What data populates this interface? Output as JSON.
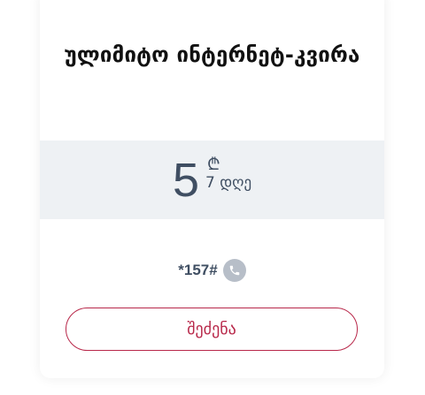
{
  "card": {
    "title": "ულიმიტო ინტერნეტ-კვირა",
    "price": {
      "amount": "5",
      "currency_symbol": "₾",
      "duration": "7 დღე"
    },
    "ussd": {
      "code": "*157#",
      "icon": "phone-icon"
    },
    "buy_label": "შეძენა"
  },
  "colors": {
    "accent": "#b8284a",
    "text_dark": "#3f4e62",
    "band_bg": "#eef1f4",
    "icon_bg": "#b7bec8"
  }
}
